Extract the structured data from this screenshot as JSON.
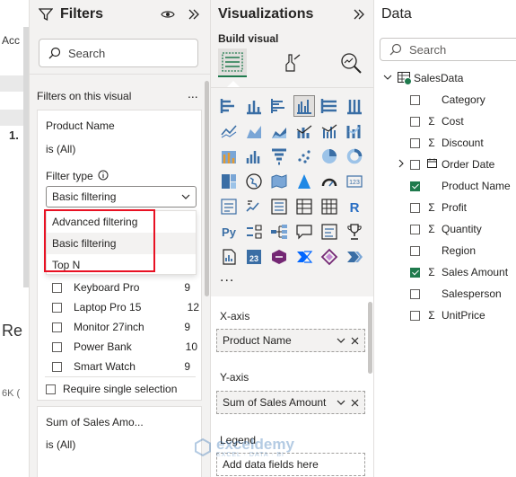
{
  "canvas": {
    "frag_tab": "Acc",
    "frag_value": "1.",
    "frag_title": "Re",
    "frag_axis": "6K ("
  },
  "filters": {
    "title": "Filters",
    "search_placeholder": "Search",
    "section_label": "Filters on this visual",
    "more_label": "...",
    "card1": {
      "field": "Product Name",
      "state": "is (All)",
      "filter_type_label": "Filter type",
      "dropdown_value": "Basic filtering",
      "menu": [
        "Advanced filtering",
        "Basic filtering",
        "Top N"
      ],
      "items": [
        {
          "label": "Keyboard Pro",
          "count": "9"
        },
        {
          "label": "Laptop Pro 15",
          "count": "12"
        },
        {
          "label": "Monitor 27inch",
          "count": "9"
        },
        {
          "label": "Power Bank",
          "count": "10"
        },
        {
          "label": "Smart Watch",
          "count": "9"
        }
      ],
      "require_single": "Require single selection"
    },
    "card2": {
      "field": "Sum of Sales Amo...",
      "state": "is (All)"
    }
  },
  "viz": {
    "title": "Visualizations",
    "build_label": "Build visual",
    "more_visuals": "...",
    "xaxis_label": "X-axis",
    "xaxis_field": "Product Name",
    "yaxis_label": "Y-axis",
    "yaxis_field": "Sum of Sales Amount",
    "legend_label": "Legend",
    "legend_placeholder": "Add data fields here"
  },
  "data": {
    "title": "Data",
    "search_placeholder": "Search",
    "table": "SalesData",
    "fields": [
      {
        "name": "Category",
        "sigma": false,
        "checked": false,
        "expand": false,
        "calendar": false
      },
      {
        "name": "Cost",
        "sigma": true,
        "checked": false,
        "expand": false,
        "calendar": false
      },
      {
        "name": "Discount",
        "sigma": true,
        "checked": false,
        "expand": false,
        "calendar": false
      },
      {
        "name": "Order Date",
        "sigma": false,
        "checked": false,
        "expand": true,
        "calendar": true
      },
      {
        "name": "Product Name",
        "sigma": false,
        "checked": true,
        "expand": false,
        "calendar": false
      },
      {
        "name": "Profit",
        "sigma": true,
        "checked": false,
        "expand": false,
        "calendar": false
      },
      {
        "name": "Quantity",
        "sigma": true,
        "checked": false,
        "expand": false,
        "calendar": false
      },
      {
        "name": "Region",
        "sigma": false,
        "checked": false,
        "expand": false,
        "calendar": false
      },
      {
        "name": "Sales Amount",
        "sigma": true,
        "checked": true,
        "expand": false,
        "calendar": false
      },
      {
        "name": "Salesperson",
        "sigma": false,
        "checked": false,
        "expand": false,
        "calendar": false
      },
      {
        "name": "UnitPrice",
        "sigma": true,
        "checked": false,
        "expand": false,
        "calendar": false
      }
    ]
  },
  "watermark": {
    "brand": "exceldemy",
    "tagline": "EXCEL · DATA · BI"
  },
  "colors": {
    "accent_green": "#1f7a4d",
    "highlight_red": "#e81123",
    "pane_bg": "#f3f2f1"
  }
}
